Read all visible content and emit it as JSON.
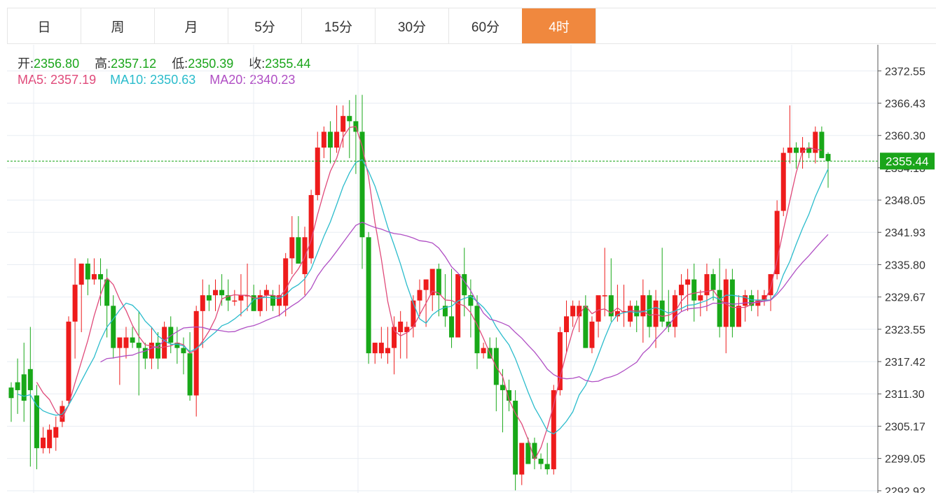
{
  "tabs": [
    "日",
    "周",
    "月",
    "5分",
    "15分",
    "30分",
    "60分",
    "4时"
  ],
  "active_tab": 7,
  "ohlc": {
    "open_label": "开:",
    "open": "2356.80",
    "high_label": "高:",
    "high": "2357.12",
    "low_label": "低:",
    "low": "2350.39",
    "close_label": "收:",
    "close": "2355.44"
  },
  "ma": {
    "ma5_label": "MA5:",
    "ma5": "2357.19",
    "ma10_label": "MA10:",
    "ma10": "2350.63",
    "ma20_label": "MA20:",
    "ma20": "2340.23"
  },
  "current_price_label": "2355.44",
  "colors": {
    "up": "#ee1c1c",
    "down": "#18a818",
    "ma5": "#e04a7a",
    "ma10": "#2bbccc",
    "ma20": "#b04fc4",
    "grid": "#e8edf3",
    "accent": "#f0883e"
  },
  "chart_data": {
    "type": "candlestick",
    "y_ticks": [
      "2372.55",
      "2366.43",
      "2360.30",
      "2354.18",
      "2348.05",
      "2341.93",
      "2335.80",
      "2329.67",
      "2323.55",
      "2317.42",
      "2311.30",
      "2305.17",
      "2299.05",
      "2292.92"
    ],
    "ylim": [
      2292.5,
      2377.5
    ],
    "current_price": 2355.44,
    "candles": [
      [
        2312.5,
        2313.5,
        2306,
        2310.5
      ],
      [
        2313.5,
        2318,
        2307.5,
        2312
      ],
      [
        2315,
        2321,
        2306,
        2310
      ],
      [
        2316,
        2324,
        2297.5,
        2312
      ],
      [
        2311,
        2313,
        2297,
        2301
      ],
      [
        2301,
        2305,
        2300,
        2303
      ],
      [
        2301,
        2305.5,
        2300,
        2304.5
      ],
      [
        2303,
        2307,
        2300.5,
        2305
      ],
      [
        2306,
        2310,
        2305,
        2309
      ],
      [
        2310,
        2326,
        2309,
        2325
      ],
      [
        2325,
        2337,
        2318,
        2332
      ],
      [
        2332,
        2336,
        2323,
        2336
      ],
      [
        2336,
        2337,
        2330,
        2333
      ],
      [
        2333,
        2337,
        2332,
        2334
      ],
      [
        2334,
        2337,
        2328,
        2333
      ],
      [
        2333,
        2335,
        2322,
        2328
      ],
      [
        2328,
        2330,
        2318,
        2320
      ],
      [
        2320,
        2322,
        2313,
        2322
      ],
      [
        2320,
        2324,
        2318,
        2322
      ],
      [
        2322,
        2324,
        2320,
        2321
      ],
      [
        2321,
        2327,
        2311,
        2320
      ],
      [
        2320,
        2321,
        2316,
        2318
      ],
      [
        2318,
        2324,
        2316,
        2321
      ],
      [
        2321,
        2323,
        2316,
        2318
      ],
      [
        2318,
        2325,
        2319,
        2324
      ],
      [
        2324,
        2326,
        2319,
        2321
      ],
      [
        2321,
        2324,
        2317,
        2320
      ],
      [
        2320,
        2322,
        2315,
        2319
      ],
      [
        2319,
        2323,
        2310,
        2311
      ],
      [
        2311,
        2328,
        2307,
        2327
      ],
      [
        2327,
        2333,
        2320,
        2330
      ],
      [
        2330,
        2332,
        2327,
        2329
      ],
      [
        2330,
        2333,
        2327,
        2331
      ],
      [
        2331,
        2334,
        2328,
        2330
      ],
      [
        2330,
        2333,
        2327,
        2329
      ],
      [
        2329,
        2331,
        2328,
        2329
      ],
      [
        2329,
        2334,
        2326,
        2330
      ],
      [
        2330,
        2336,
        2327,
        2330
      ],
      [
        2330,
        2332,
        2329,
        2327
      ],
      [
        2327,
        2331,
        2326,
        2330
      ],
      [
        2330,
        2332,
        2327,
        2331
      ],
      [
        2330,
        2331,
        2327,
        2328
      ],
      [
        2328,
        2332,
        2326,
        2330
      ],
      [
        2328,
        2338,
        2326,
        2337
      ],
      [
        2337,
        2345,
        2334,
        2341
      ],
      [
        2341,
        2345,
        2336,
        2336
      ],
      [
        2334,
        2343,
        2330,
        2341
      ],
      [
        2337,
        2350,
        2336,
        2349
      ],
      [
        2349,
        2361,
        2348,
        2358
      ],
      [
        2358,
        2362,
        2356,
        2361
      ],
      [
        2361,
        2363,
        2355,
        2358
      ],
      [
        2358,
        2366,
        2357,
        2361
      ],
      [
        2361,
        2366,
        2358,
        2364
      ],
      [
        2364,
        2367,
        2356,
        2363
      ],
      [
        2363,
        2368,
        2353,
        2361
      ],
      [
        2361,
        2368,
        2335,
        2341
      ],
      [
        2341,
        2342,
        2317,
        2319
      ],
      [
        2319,
        2321,
        2317,
        2321
      ],
      [
        2319,
        2324,
        2318,
        2321
      ],
      [
        2319,
        2324,
        2317,
        2320
      ],
      [
        2320,
        2326,
        2315,
        2324
      ],
      [
        2323,
        2327,
        2318,
        2325
      ],
      [
        2323,
        2325,
        2318,
        2324
      ],
      [
        2324,
        2330,
        2322,
        2329
      ],
      [
        2329,
        2333,
        2326,
        2331
      ],
      [
        2331,
        2333,
        2324,
        2333
      ],
      [
        2330,
        2334,
        2327,
        2335
      ],
      [
        2335,
        2336,
        2326,
        2330
      ],
      [
        2328,
        2334,
        2324,
        2326
      ],
      [
        2326,
        2335,
        2320,
        2322
      ],
      [
        2322,
        2331,
        2325,
        2334
      ],
      [
        2334,
        2339,
        2326,
        2330
      ],
      [
        2330,
        2333,
        2322,
        2328
      ],
      [
        2328,
        2330,
        2316,
        2319
      ],
      [
        2319,
        2321,
        2318,
        2320
      ],
      [
        2320,
        2322,
        2318,
        2318
      ],
      [
        2320,
        2322,
        2308,
        2313
      ],
      [
        2313,
        2316,
        2304,
        2312
      ],
      [
        2312,
        2314,
        2308,
        2310
      ],
      [
        2310,
        2312,
        2293,
        2296
      ],
      [
        2296,
        2298,
        2294,
        2302
      ],
      [
        2302,
        2303,
        2298,
        2298
      ],
      [
        2302,
        2303,
        2297,
        2299
      ],
      [
        2299,
        2300,
        2297,
        2298
      ],
      [
        2298,
        2302,
        2296,
        2297
      ],
      [
        2297,
        2313,
        2296,
        2312
      ],
      [
        2312,
        2324,
        2311,
        2323
      ],
      [
        2323,
        2329,
        2319,
        2326
      ],
      [
        2326,
        2329,
        2324,
        2328
      ],
      [
        2326,
        2329,
        2323,
        2328
      ],
      [
        2328,
        2330,
        2320,
        2320
      ],
      [
        2320,
        2326,
        2319,
        2325
      ],
      [
        2325,
        2329,
        2322,
        2330
      ],
      [
        2330,
        2339,
        2326,
        2330
      ],
      [
        2330,
        2337,
        2325,
        2326
      ],
      [
        2326,
        2332,
        2325,
        2327
      ],
      [
        2327,
        2332,
        2324,
        2327
      ],
      [
        2325,
        2329,
        2324,
        2328
      ],
      [
        2328,
        2329,
        2323,
        2326
      ],
      [
        2326,
        2333,
        2321,
        2330
      ],
      [
        2330,
        2331,
        2322,
        2324
      ],
      [
        2324,
        2331,
        2320,
        2329
      ],
      [
        2329,
        2339,
        2324,
        2325
      ],
      [
        2325,
        2331,
        2323,
        2324
      ],
      [
        2324,
        2331,
        2322,
        2330
      ],
      [
        2330,
        2334,
        2327,
        2332
      ],
      [
        2332,
        2335,
        2327,
        2333
      ],
      [
        2333,
        2336,
        2325,
        2329
      ],
      [
        2329,
        2331,
        2326,
        2330
      ],
      [
        2330,
        2336,
        2327,
        2334
      ],
      [
        2334,
        2335,
        2329,
        2331
      ],
      [
        2331,
        2337,
        2322,
        2324
      ],
      [
        2324,
        2335,
        2319,
        2333
      ],
      [
        2333,
        2335,
        2322,
        2324
      ],
      [
        2324,
        2330,
        2324,
        2328
      ],
      [
        2328,
        2331,
        2325,
        2330
      ],
      [
        2330,
        2331,
        2327,
        2328
      ],
      [
        2328,
        2331,
        2326,
        2329
      ],
      [
        2329,
        2331,
        2328,
        2330
      ],
      [
        2330,
        2331,
        2327,
        2334
      ],
      [
        2334,
        2348,
        2333,
        2346
      ],
      [
        2346,
        2358,
        2345,
        2357
      ],
      [
        2357,
        2366,
        2355,
        2358
      ],
      [
        2358,
        2359,
        2354,
        2357
      ],
      [
        2357,
        2360,
        2354,
        2358
      ],
      [
        2358,
        2359,
        2356,
        2357
      ],
      [
        2357,
        2362,
        2355,
        2361
      ],
      [
        2361,
        2362,
        2356,
        2356
      ],
      [
        2356.8,
        2357.12,
        2350.39,
        2355.44
      ]
    ],
    "ma5": [
      null,
      null,
      null,
      null,
      2313.5,
      2311.5,
      2310.2,
      2307.9,
      2306.7,
      2309.2,
      2313.4,
      2317.4,
      2321.4,
      2326.1,
      2330.1,
      2333.3,
      2332.0,
      2329.2,
      2327.1,
      2324.3,
      2322.2,
      2320.6,
      2320.4,
      2320.0,
      2320.2,
      2320.4,
      2321.0,
      2320.6,
      2319.0,
      2319.7,
      2321.3,
      2323.2,
      2325.6,
      2329.3,
      2329.8,
      2330.1,
      2330.0,
      2330.0,
      2329.5,
      2329.4,
      2330.0,
      2330.0,
      2329.6,
      2331.1,
      2333.4,
      2335.0,
      2337.2,
      2340.4,
      2345.3,
      2349.6,
      2353.5,
      2356.0,
      2360.0,
      2361.8,
      2362.0,
      2358.2,
      2352.4,
      2343.8,
      2336.9,
      2328.8,
      2323.3,
      2322.3,
      2322.9,
      2324.0,
      2326.3,
      2328.5,
      2330.8,
      2330.4,
      2329.1,
      2329.0,
      2328.4,
      2328.0,
      2326.7,
      2324.4,
      2321.8,
      2319.0,
      2316.4,
      2314.6,
      2310.2,
      2307.6,
      2305.6,
      2302.6,
      2298.8,
      2301.1,
      2304.8,
      2309.2,
      2314.4,
      2319.1,
      2323.3,
      2326.4,
      2328.0,
      2326.5,
      2327.2,
      2327.4,
      2326.6,
      2327.6,
      2326.7,
      2327.1,
      2327.0,
      2327.0,
      2326.2,
      2326.4,
      2326.0,
      2326.2,
      2326.8,
      2328.9,
      2330.1,
      2330.4,
      2330.6,
      2330.7,
      2331.0,
      2329.2,
      2328.3,
      2327.7,
      2327.7,
      2327.7,
      2328.3,
      2329.0,
      2328.8,
      2331.4,
      2336.6,
      2342.4,
      2347.9,
      2353.3,
      2357.3,
      2358.0,
      2357.7,
      2357.5
    ]
  }
}
